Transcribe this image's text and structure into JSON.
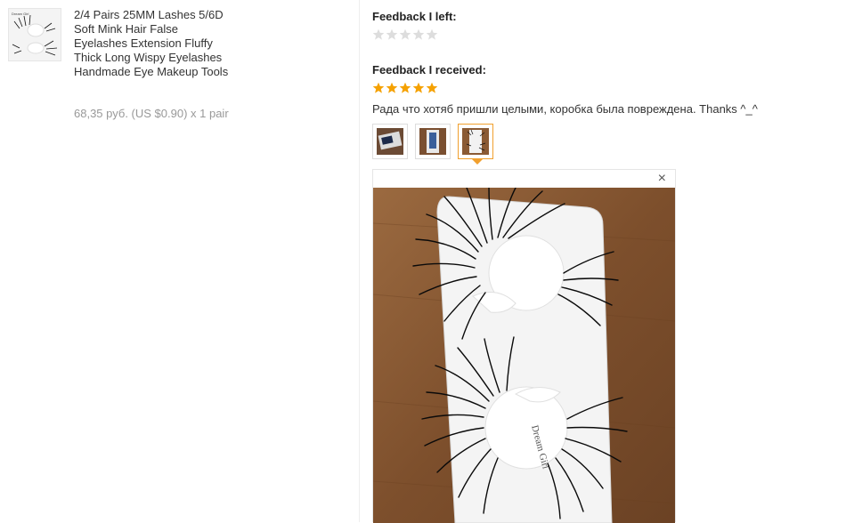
{
  "product": {
    "title": "2/4 Pairs 25MM Lashes 5/6D Soft Mink Hair False Eyelashes Extension Fluffy Thick Long Wispy Eyelashes Handmade Eye Makeup Tools",
    "price": "68,35 руб. (US $0.90) x 1 pair",
    "thumb_label": "Dream Girl"
  },
  "feedback_left": {
    "label": "Feedback I left:",
    "rating": 0,
    "max": 5
  },
  "feedback_received": {
    "label": "Feedback I received:",
    "rating": 5,
    "max": 5,
    "text": "Рада что хотяб пришли целыми, коробка была повреждена. Thanks ^_^"
  },
  "photos": {
    "count": 3,
    "active_index": 2,
    "tray_text": "Dream Girl",
    "close_symbol": "×"
  },
  "colors": {
    "star_filled": "#f5a100",
    "star_empty": "#dddddd",
    "active_border": "#f1a02e",
    "wood": "#8a5a34"
  },
  "icons": {
    "close": "close-icon",
    "star": "star-icon"
  }
}
